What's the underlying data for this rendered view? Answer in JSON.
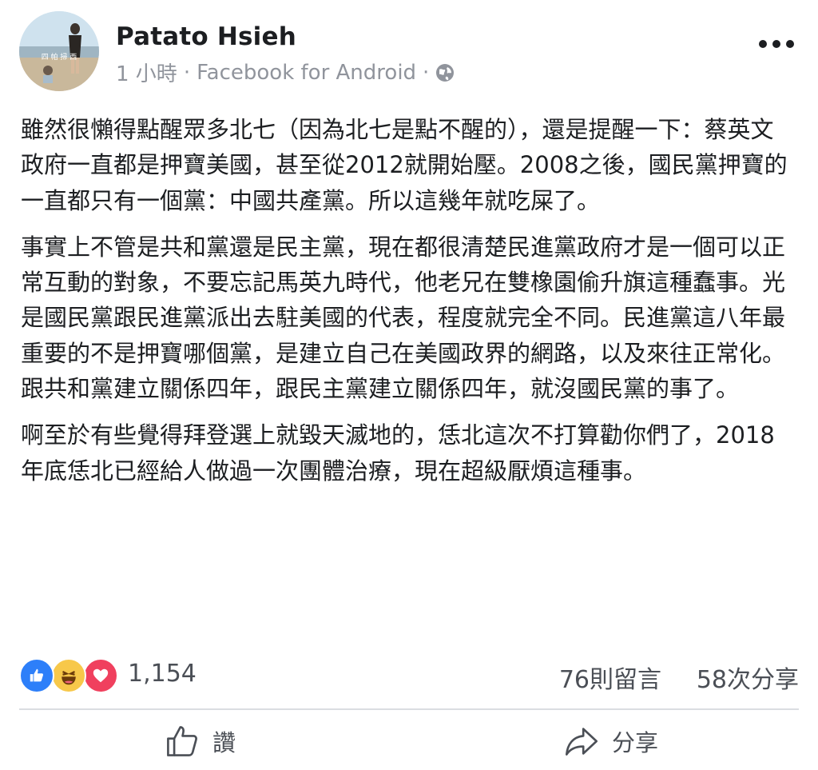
{
  "post": {
    "author": "Patato Hsieh",
    "time": "1 小時",
    "sep1": "·",
    "source": "Facebook for Android",
    "sep2": "·",
    "avatar_caption": "四 帕 掃 西",
    "privacy_icon": "globe-icon",
    "more_icon": "more-dots-icon",
    "paragraphs": [
      "雖然很懶得點醒眾多北七（因為北七是點不醒的），還是提醒一下：蔡英文政府一直都是押寶美國，甚至從2012就開始壓。2008之後，國民黨押寶的一直都只有一個黨：中國共產黨。所以這幾年就吃屎了。",
      "事實上不管是共和黨還是民主黨，現在都很清楚民進黨政府才是一個可以正常互動的對象，不要忘記馬英九時代，他老兄在雙橡園偷升旗這種蠢事。光是國民黨跟民進黨派出去駐美國的代表，程度就完全不同。民進黨這八年最重要的不是押寶哪個黨，是建立自己在美國政界的網路，以及來往正常化。跟共和黨建立關係四年，跟民主黨建立關係四年，就沒國民黨的事了。",
      "啊至於有些覺得拜登選上就毀天滅地的，恁北這次不打算勸你們了，2018年底恁北已經給人做過一次團體治療，現在超級厭煩這種事。"
    ]
  },
  "stats": {
    "reactions": [
      "like",
      "haha",
      "love"
    ],
    "reaction_count": "1,154",
    "comments": "76則留言",
    "shares": "58次分享"
  },
  "actions": {
    "like_label": "讚",
    "share_label": "分享"
  },
  "colors": {
    "like": "#2d7ff9",
    "haha": "#f7c84a",
    "love": "#f0405e",
    "secondary_text": "#90949c"
  }
}
